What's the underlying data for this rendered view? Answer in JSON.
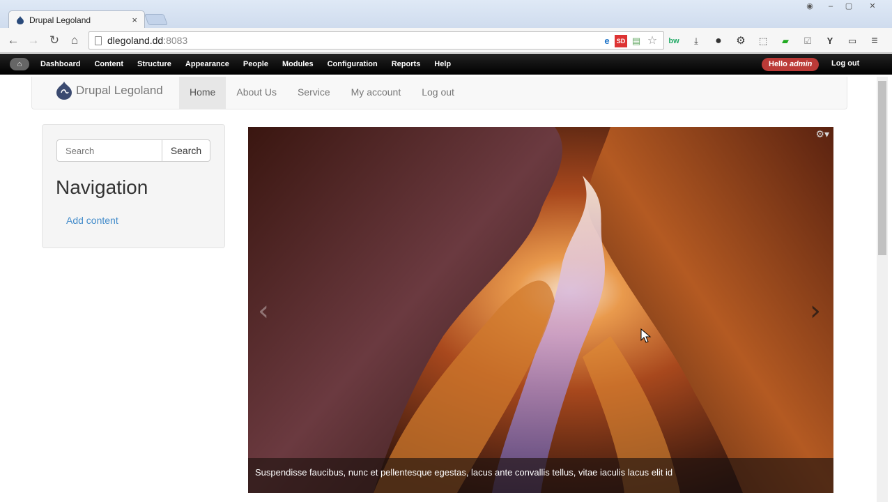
{
  "browser": {
    "tab_title": "Drupal Legoland",
    "tab_close": "×",
    "url_host": "dlegoland.dd",
    "url_port": ":8083",
    "back": "←",
    "forward": "→",
    "reload": "↻",
    "home": "⌂",
    "ext_sd": "SD",
    "ext_y": "Y",
    "menu": "≡"
  },
  "admin_toolbar": {
    "home": "⌂",
    "items": [
      "Dashboard",
      "Content",
      "Structure",
      "Appearance",
      "People",
      "Modules",
      "Configuration",
      "Reports",
      "Help"
    ],
    "hello_prefix": "Hello ",
    "hello_user": "admin",
    "logout": "Log out"
  },
  "site": {
    "brand": "Drupal Legoland",
    "nav": [
      "Home",
      "About Us",
      "Service",
      "My account",
      "Log out"
    ],
    "active_nav": "Home"
  },
  "sidebar": {
    "search_placeholder": "Search",
    "search_button": "Search",
    "title": "Navigation",
    "link": "Add content"
  },
  "carousel": {
    "caption": "Suspendisse faucibus, nunc et pellentesque egestas, lacus ante convallis tellus, vitae iaculis lacus elit id",
    "prev": "‹",
    "next": "›",
    "settings": "⚙▾"
  }
}
